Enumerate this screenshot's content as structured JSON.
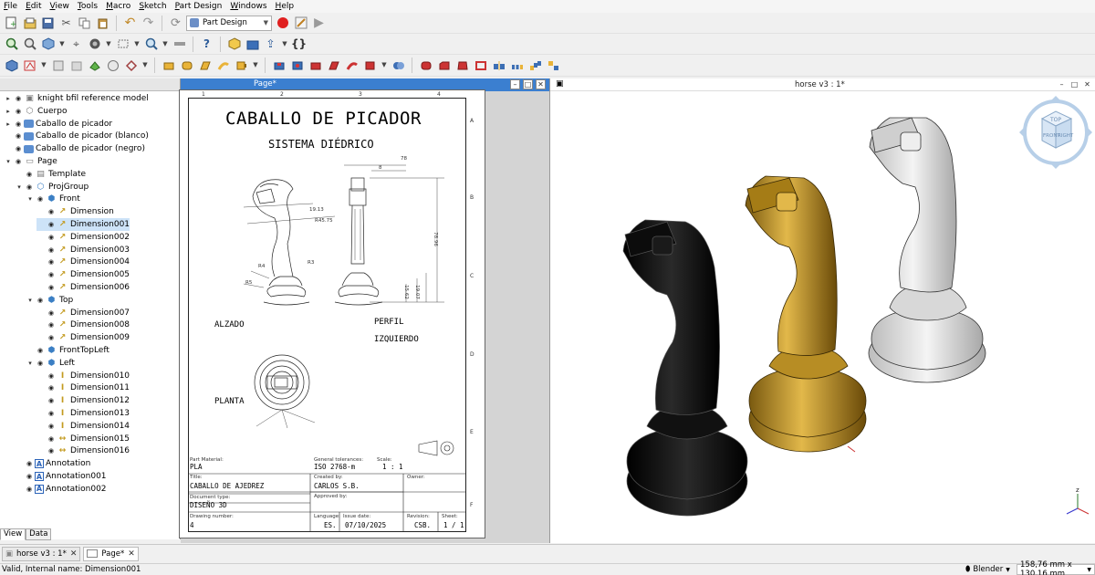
{
  "menu": [
    "File",
    "Edit",
    "View",
    "Tools",
    "Macro",
    "Sketch",
    "Part Design",
    "Windows",
    "Help"
  ],
  "workbench": {
    "selected": "Part Design"
  },
  "tree": {
    "items": [
      {
        "label": "knight bfil reference model",
        "level": 0,
        "icon": "box-icon"
      },
      {
        "label": "Cuerpo",
        "level": 0,
        "icon": "body-icon"
      },
      {
        "label": "Caballo de picador",
        "level": 0,
        "icon": "part-icon"
      },
      {
        "label": "Caballo de picador (blanco)",
        "level": 0,
        "icon": "part-icon"
      },
      {
        "label": "Caballo de picador (negro)",
        "level": 0,
        "icon": "part-icon"
      },
      {
        "label": "Page",
        "level": 0,
        "icon": "page-icon"
      },
      {
        "label": "Template",
        "level": 1,
        "icon": "template-icon"
      },
      {
        "label": "ProjGroup",
        "level": 1,
        "icon": "projgroup-icon"
      },
      {
        "label": "Front",
        "level": 2,
        "icon": "view-icon"
      },
      {
        "label": "Dimension",
        "level": 3,
        "icon": "dimension-icon"
      },
      {
        "label": "Dimension001",
        "level": 3,
        "icon": "dimension-icon"
      },
      {
        "label": "Dimension002",
        "level": 3,
        "icon": "dimension-icon"
      },
      {
        "label": "Dimension003",
        "level": 3,
        "icon": "dimension-icon"
      },
      {
        "label": "Dimension004",
        "level": 3,
        "icon": "dimension-icon"
      },
      {
        "label": "Dimension005",
        "level": 3,
        "icon": "dimension-icon"
      },
      {
        "label": "Dimension006",
        "level": 3,
        "icon": "dimension-icon"
      },
      {
        "label": "Top",
        "level": 2,
        "icon": "view-icon"
      },
      {
        "label": "Dimension007",
        "level": 3,
        "icon": "dimension-icon"
      },
      {
        "label": "Dimension008",
        "level": 3,
        "icon": "dimension-icon"
      },
      {
        "label": "Dimension009",
        "level": 3,
        "icon": "dimension-icon"
      },
      {
        "label": "FrontTopLeft",
        "level": 2,
        "icon": "view-icon"
      },
      {
        "label": "Left",
        "level": 2,
        "icon": "view-icon"
      },
      {
        "label": "Dimension010",
        "level": 3,
        "icon": "vertical-dimension-icon"
      },
      {
        "label": "Dimension011",
        "level": 3,
        "icon": "vertical-dimension-icon"
      },
      {
        "label": "Dimension012",
        "level": 3,
        "icon": "vertical-dimension-icon"
      },
      {
        "label": "Dimension013",
        "level": 3,
        "icon": "vertical-dimension-icon"
      },
      {
        "label": "Dimension014",
        "level": 3,
        "icon": "vertical-dimension-icon"
      },
      {
        "label": "Dimension015",
        "level": 3,
        "icon": "horizontal-dimension-icon"
      },
      {
        "label": "Dimension016",
        "level": 3,
        "icon": "horizontal-dimension-icon"
      },
      {
        "label": "Annotation",
        "level": 1,
        "icon": "annotation-icon"
      },
      {
        "label": "Annotation001",
        "level": 1,
        "icon": "annotation-icon"
      },
      {
        "label": "Annotation002",
        "level": 1,
        "icon": "annotation-icon"
      }
    ]
  },
  "panel_tabs": [
    "View",
    "Data"
  ],
  "page_window": {
    "title": "Page*"
  },
  "view3d": {
    "title": "horse v3 : 1*"
  },
  "drawing": {
    "title": "CABALLO DE PICADOR",
    "subtitle": "SISTEMA DIÉDRICO",
    "label_alzado": "ALZADO",
    "label_perfil": "PERFIL",
    "label_izquierdo": "IZQUIERDO",
    "label_planta": "PLANTA",
    "cols": [
      "1",
      "2",
      "3",
      "4"
    ],
    "rows": [
      "A",
      "B",
      "C",
      "D",
      "E",
      "F"
    ],
    "dims": {
      "d1": "78",
      "d2": "8",
      "d3": "78.96",
      "d4": "19.13",
      "d5": "R45.75",
      "d6": "R5",
      "d7": "19.07",
      "d8": "15.62",
      "d9": "R4",
      "d10": "R3"
    },
    "title_block": {
      "part_material_label": "Part Material:",
      "part_material": "PLA",
      "general_tol_label": "General tolerances:",
      "general_tol": "ISO 2768-m",
      "scale_label": "Scale:",
      "scale": "1 : 1",
      "title_label": "Title:",
      "title": "CABALLO DE AJEDREZ",
      "created_by_label": "Created by:",
      "created_by": "CARLOS S.B.",
      "owner_label": "Owner:",
      "doc_type_label": "Document type:",
      "doc_type": "DISEÑO 3D",
      "approved_label": "Approved by:",
      "drawing_number_label": "Drawing number:",
      "drawing_number": "4",
      "language_label": "Language:",
      "language": "ES.",
      "issue_label": "Issue date:",
      "issue": "07/10/2025",
      "revision_label": "Revision:",
      "revision": "CSB.",
      "sheet_label": "Sheet:",
      "sheet": "1 / 1"
    }
  },
  "navcube": {
    "top": "TOP",
    "front": "FRONT",
    "right": "RIGHT"
  },
  "doc_tabs": [
    {
      "label": "horse v3 : 1*",
      "active": false
    },
    {
      "label": "Page*",
      "active": true
    }
  ],
  "status": {
    "message": "Valid, Internal name: Dimension001",
    "nav_style": "Blender",
    "dims": "158,76 mm x 130,16 mm"
  },
  "colors": {
    "title_bar": "#3b7fd0",
    "gold_piece": "#c4971e",
    "black_piece": "#0b0b0b",
    "white_piece": "#dcdcdc",
    "record": "#e02020"
  }
}
